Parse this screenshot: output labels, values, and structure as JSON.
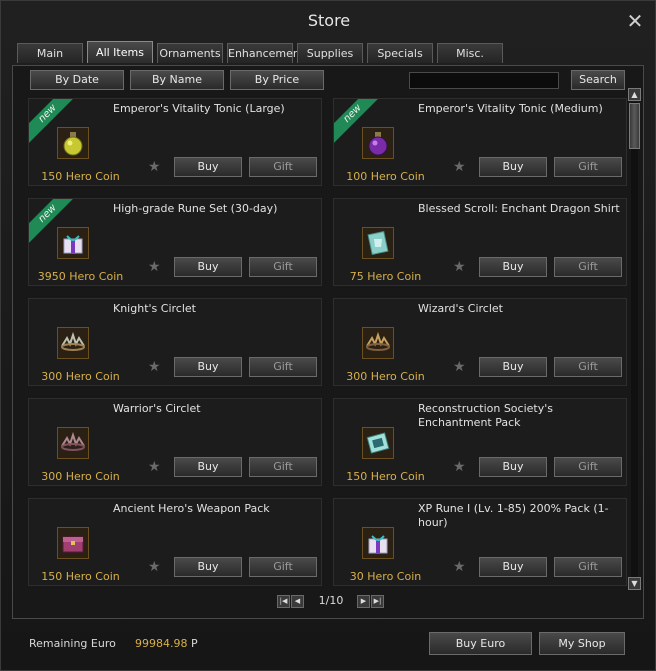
{
  "window": {
    "title": "Store",
    "close_icon": "close-icon"
  },
  "tabs": [
    {
      "label": "Main",
      "active": false
    },
    {
      "label": "All Items",
      "active": true
    },
    {
      "label": "Ornaments",
      "active": false
    },
    {
      "label": "Enhancement",
      "active": false
    },
    {
      "label": "Supplies",
      "active": false
    },
    {
      "label": "Specials",
      "active": false
    },
    {
      "label": "Misc.",
      "active": false
    }
  ],
  "sort": {
    "by_date": "By Date",
    "by_name": "By Name",
    "by_price": "By Price"
  },
  "search": {
    "value": "",
    "button": "Search"
  },
  "badge_new": "new",
  "buy_label": "Buy",
  "gift_label": "Gift",
  "items": [
    {
      "name": "Emperor's Vitality Tonic (Large)",
      "price": "150 Hero Coin",
      "new": true,
      "icon": "yellow-potion-icon"
    },
    {
      "name": "Emperor's Vitality Tonic (Medium)",
      "price": "100 Hero Coin",
      "new": true,
      "icon": "purple-potion-icon"
    },
    {
      "name": "High-grade Rune Set (30-day)",
      "price": "3950 Hero Coin",
      "new": true,
      "icon": "gift-box-icon"
    },
    {
      "name": "Blessed Scroll: Enchant Dragon Shirt",
      "price": "75 Hero Coin",
      "new": false,
      "icon": "shirt-scroll-icon"
    },
    {
      "name": "Knight's Circlet",
      "price": "300 Hero Coin",
      "new": false,
      "icon": "circlet-icon"
    },
    {
      "name": "Wizard's Circlet",
      "price": "300 Hero Coin",
      "new": false,
      "icon": "circlet-icon"
    },
    {
      "name": "Warrior's Circlet",
      "price": "300 Hero Coin",
      "new": false,
      "icon": "circlet-icon"
    },
    {
      "name": "Reconstruction Society's Enchantment Pack",
      "price": "150 Hero Coin",
      "new": false,
      "icon": "pack-icon"
    },
    {
      "name": "Ancient Hero's Weapon Pack",
      "price": "150 Hero Coin",
      "new": false,
      "icon": "chest-icon"
    },
    {
      "name": "XP Rune I (Lv. 1-85) 200% Pack (1-hour)",
      "price": "30 Hero Coin",
      "new": false,
      "icon": "gift-box-icon"
    }
  ],
  "pagination": {
    "current": 1,
    "total": 10,
    "text": "1/10"
  },
  "footer": {
    "remaining_label": "Remaining Euro",
    "amount": "99984.98",
    "currency": "P",
    "buy_euro": "Buy Euro",
    "my_shop": "My Shop"
  }
}
